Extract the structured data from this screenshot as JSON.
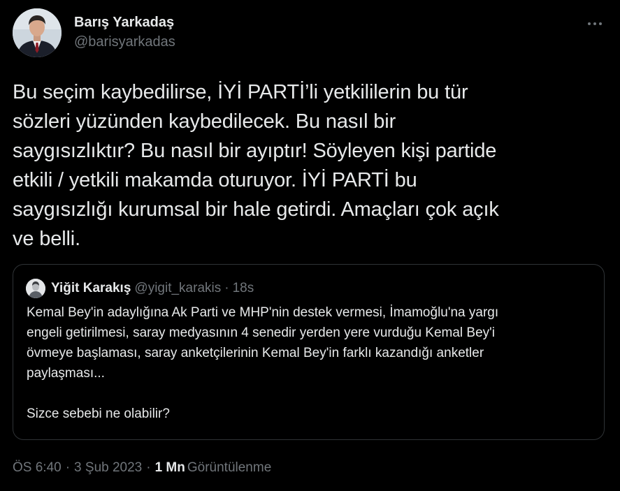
{
  "author": {
    "name": "Barış Yarkadaş",
    "handle": "@barisyarkadas"
  },
  "more_icon": "more-horizontal-icon",
  "tweet": {
    "text": "Bu seçim kaybedilirse, İYİ PARTİ’li yetkililerin bu tür\nsözleri yüzünden kaybedilecek. Bu nasıl bir\nsaygısızlıktır? Bu nasıl bir ayıptır! Söyleyen kişi partide\netkili / yetkili makamda oturuyor. İYİ PARTİ bu\nsaygısızlığı kurumsal bir hale getirdi. Amaçları çok açık\nve belli."
  },
  "quoted_tweet": {
    "name": "Yiğit Karakış",
    "handle": "@yigit_karakis",
    "separator": "·",
    "time": "18s",
    "text": "Kemal Bey'in adaylığına Ak Parti ve MHP'nin destek vermesi, İmamoğlu'na yargı\nengeli getirilmesi, saray medyasının 4 senedir yerden yere vurduğu Kemal Bey'i\növmeye başlaması, saray anketçilerinin Kemal Bey'in farklı kazandığı anketler\npaylaşması...\n\nSizce sebebi ne olabilir?"
  },
  "meta": {
    "time": "ÖS 6:40",
    "separator": "·",
    "date": "3 Şub 2023",
    "views_count": "1 Mn",
    "views_label": "Görüntülenme"
  },
  "colors": {
    "background": "#000000",
    "text_primary": "#e7e9ea",
    "text_secondary": "#71767b",
    "border": "#2f3336"
  }
}
